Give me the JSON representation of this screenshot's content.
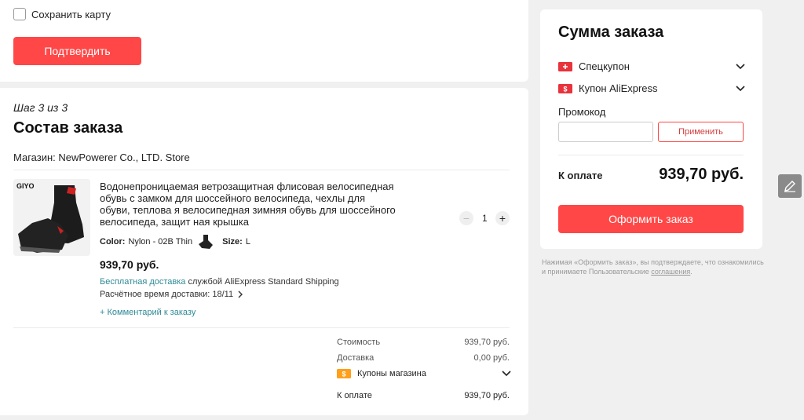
{
  "card": {
    "save_card_label": "Сохранить карту",
    "confirm_button": "Подтвердить"
  },
  "order": {
    "step": "Шаг 3 из 3",
    "title": "Состав заказа",
    "store": "Магазин: NewPowerer Co., LTD. Store",
    "product": {
      "brand_logo": "GIYO",
      "title": "Водонепроницаемая ветрозащитная флисовая велосипедная обувь с замком для шоссейного велосипеда, чехлы для обуви, теплова я велосипедная зимняя обувь для шоссейного велосипеда, защит ная крышка",
      "color_label": "Color:",
      "color_value": "Nylon - 02B Thin",
      "size_label": "Size:",
      "size_value": "L",
      "price": "939,70 руб.",
      "shipping_free": "Бесплатная доставка",
      "shipping_rest": "службой AliExpress Standard Shipping",
      "delivery_time": "Расчётное время доставки: 18/11",
      "comment_link": "+ Комментарий к заказу",
      "quantity": "1",
      "qty_minus": "−",
      "qty_plus": "+"
    },
    "totals": {
      "cost_label": "Стоимость",
      "cost_value": "939,70 руб.",
      "delivery_label": "Доставка",
      "delivery_value": "0,00 руб.",
      "store_coupons_label": "Купоны магазина",
      "pay_label": "К оплате",
      "pay_value": "939,70 руб."
    }
  },
  "summary": {
    "title": "Сумма заказа",
    "special_coupon": "Спецкупон",
    "aliexpress_coupon": "Купон AliExpress",
    "promo_label": "Промокод",
    "promo_placeholder": "",
    "apply_button": "Применить",
    "pay_label": "К оплате",
    "pay_value": "939,70 руб.",
    "checkout_button": "Оформить заказ",
    "disclaimer_text": "Нажимая «Оформить заказ», вы подтверждаете, что ознакомились и принимаете Пользовательские ",
    "disclaimer_link": "соглашения",
    "disclaimer_end": "."
  },
  "icons": {
    "coupon": "coupon-icon",
    "chevron": "chevron-down-icon",
    "edit": "pencil-icon"
  },
  "colors": {
    "accent": "#ff4747",
    "link": "#2e8a96"
  }
}
